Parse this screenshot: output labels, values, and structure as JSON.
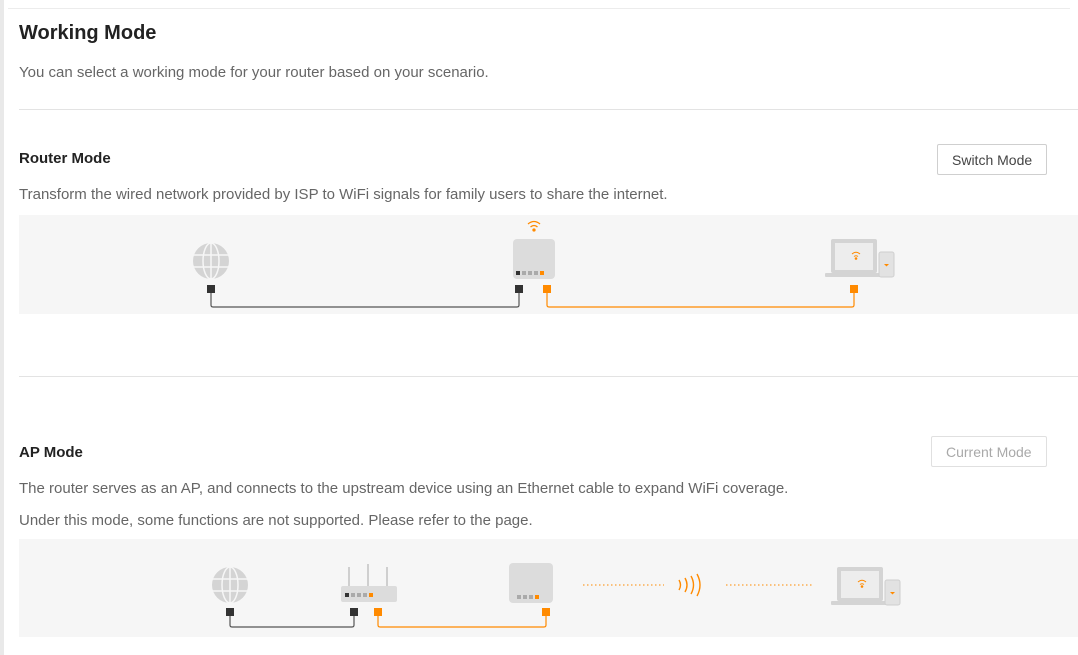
{
  "page": {
    "title": "Working Mode",
    "description": "You can select a working mode for your router based on your scenario."
  },
  "modes": [
    {
      "title": "Router Mode",
      "description": "Transform the wired network provided by ISP to WiFi signals for family users to share the internet.",
      "button_label": "Switch Mode",
      "button_enabled": true
    },
    {
      "title": "AP Mode",
      "description_lines": [
        "The router serves as an AP, and connects to the upstream device using an Ethernet cable to expand WiFi coverage.",
        "Under this mode, some functions are not supported. Please refer to the page."
      ],
      "button_label": "Current Mode",
      "button_enabled": false
    }
  ],
  "colors": {
    "accent": "#ff8a00",
    "wire": "#555555",
    "device": "#d9d9d9"
  },
  "icons": [
    "globe-icon",
    "router-icon",
    "laptop-icon",
    "phone-icon",
    "wifi-icon",
    "ethernet-port-icon",
    "wireless-signal-icon"
  ]
}
